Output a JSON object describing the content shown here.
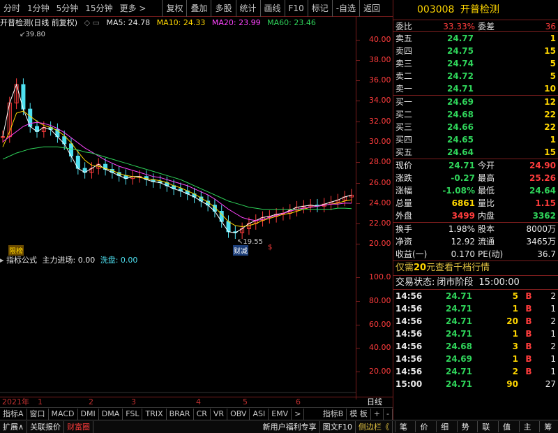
{
  "toolbar": {
    "items": [
      "分时",
      "1分钟",
      "5分钟",
      "15分钟",
      "更多 >",
      "复权",
      "叠加",
      "多股",
      "统计",
      "画线",
      "F10",
      "标记",
      "-自选",
      "返回"
    ]
  },
  "legend": {
    "name": "开普检测(日线 前复权)",
    "ma5": "MA5: 24.78",
    "ma10": "MA10: 24.33",
    "ma20": "MA20: 23.99",
    "ma60": "MA60: 23.46"
  },
  "price_axis": [
    "40.00",
    "38.00",
    "36.00",
    "34.00",
    "32.00",
    "30.00",
    "28.00",
    "26.00",
    "24.00",
    "22.00",
    "20.00"
  ],
  "vol_axis": [
    "100.0",
    "80.00",
    "60.00",
    "40.00",
    "20.00"
  ],
  "annotations": {
    "high": "39.80",
    "low": "19.55",
    "tag1": "限榜",
    "tag2": "财减",
    "tag3": "$"
  },
  "subleg": {
    "name": "指标公式",
    "main_in": "主力进场: 0.00",
    "wash": "洗盘: 0.00"
  },
  "datebar": {
    "year": "2021年",
    "m1": "1",
    "m2": "2",
    "m3": "3",
    "m4": "4",
    "m5": "5",
    "m6": "6",
    "period": "日线"
  },
  "indicators": [
    "指标A",
    "窗口",
    "MACD",
    "DMI",
    "DMA",
    "FSL",
    "TRIX",
    "BRAR",
    "CR",
    "VR",
    "OBV",
    "ASI",
    "EMV",
    ">",
    "指标B",
    "模 板",
    "+",
    "-"
  ],
  "bottombar": {
    "expand": "扩展∧",
    "related": "关联报价",
    "wealth": "财富圈",
    "promo": "新用户福利专享",
    "f10": "图文F10",
    "sidebar": "侧边栏《"
  },
  "panel_tabs": [
    "笔",
    "价",
    "细",
    "势",
    "联",
    "值",
    "主",
    "筹"
  ],
  "stock": {
    "code": "003008",
    "name": "开普检测"
  },
  "weibi": {
    "label": "委比",
    "value": "33.33%",
    "diff_label": "委差",
    "diff": "36"
  },
  "asks": [
    {
      "label": "卖五",
      "price": "24.77",
      "vol": "1"
    },
    {
      "label": "卖四",
      "price": "24.75",
      "vol": "15"
    },
    {
      "label": "卖三",
      "price": "24.74",
      "vol": "5"
    },
    {
      "label": "卖二",
      "price": "24.72",
      "vol": "5"
    },
    {
      "label": "卖一",
      "price": "24.71",
      "vol": "10"
    }
  ],
  "bids": [
    {
      "label": "买一",
      "price": "24.69",
      "vol": "12"
    },
    {
      "label": "买二",
      "price": "24.68",
      "vol": "22"
    },
    {
      "label": "买三",
      "price": "24.66",
      "vol": "22"
    },
    {
      "label": "买四",
      "price": "24.65",
      "vol": "1"
    },
    {
      "label": "买五",
      "price": "24.64",
      "vol": "15"
    }
  ],
  "quote": [
    {
      "l1": "现价",
      "v1": "24.71",
      "c1": "green",
      "l2": "今开",
      "v2": "24.90",
      "c2": "red"
    },
    {
      "l1": "涨跌",
      "v1": "-0.27",
      "c1": "green",
      "l2": "最高",
      "v2": "25.26",
      "c2": "red"
    },
    {
      "l1": "涨幅",
      "v1": "-1.08%",
      "c1": "green",
      "l2": "最低",
      "v2": "24.64",
      "c2": "green"
    },
    {
      "l1": "总量",
      "v1": "6861",
      "c1": "yellow",
      "l2": "量比",
      "v2": "1.15",
      "c2": "red"
    },
    {
      "l1": "外盘",
      "v1": "3499",
      "c1": "red",
      "l2": "内盘",
      "v2": "3362",
      "c2": "green"
    }
  ],
  "fundamentals": [
    {
      "l1": "换手",
      "v1": "1.98%",
      "l2": "股本",
      "v2": "8000万"
    },
    {
      "l1": "净资",
      "v1": "12.92",
      "l2": "流通",
      "v2": "3465万"
    },
    {
      "l1": "收益(一)",
      "v1": "0.170",
      "l2": "PE(动)",
      "v2": "36.7"
    }
  ],
  "promo_line": {
    "pre": "仅需",
    "num": "20",
    "post": "元查看千档行情"
  },
  "trade_status": {
    "label": "交易状态:",
    "value": "闭市阶段",
    "time": "15:00:00"
  },
  "ticks": [
    {
      "t": "14:56",
      "p": "24.71",
      "pc": "green",
      "v": "5",
      "s": "B",
      "n": "2"
    },
    {
      "t": "14:56",
      "p": "24.71",
      "pc": "green",
      "v": "1",
      "s": "B",
      "n": "1"
    },
    {
      "t": "14:56",
      "p": "24.71",
      "pc": "green",
      "v": "20",
      "s": "B",
      "n": "2"
    },
    {
      "t": "14:56",
      "p": "24.71",
      "pc": "green",
      "v": "1",
      "s": "B",
      "n": "1"
    },
    {
      "t": "14:56",
      "p": "24.68",
      "pc": "green",
      "v": "3",
      "s": "B",
      "n": "2"
    },
    {
      "t": "14:56",
      "p": "24.69",
      "pc": "green",
      "v": "1",
      "s": "B",
      "n": "1"
    },
    {
      "t": "14:56",
      "p": "24.71",
      "pc": "green",
      "v": "2",
      "s": "B",
      "n": "1"
    },
    {
      "t": "15:00",
      "p": "24.71",
      "pc": "green",
      "v": "90",
      "s": "",
      "n": "27"
    }
  ],
  "chart_data": [
    {
      "type": "line",
      "title": "开普检测(日线 前复权)",
      "ylim": [
        19,
        41
      ],
      "x": [
        "2021-01-04",
        "2021-01-06",
        "2021-01-08",
        "2021-01-12",
        "2021-01-14",
        "2021-01-18",
        "2021-01-20",
        "2021-01-22",
        "2021-01-26",
        "2021-01-28",
        "2021-02-01",
        "2021-02-03",
        "2021-02-05",
        "2021-02-09",
        "2021-02-19",
        "2021-02-23",
        "2021-02-25",
        "2021-03-01",
        "2021-03-03",
        "2021-03-05",
        "2021-03-09",
        "2021-03-11",
        "2021-03-15",
        "2021-03-17",
        "2021-03-19",
        "2021-03-23",
        "2021-03-25",
        "2021-03-29",
        "2021-03-31",
        "2021-04-02",
        "2021-04-07",
        "2021-04-09",
        "2021-04-13",
        "2021-04-15",
        "2021-04-19",
        "2021-04-21",
        "2021-04-23",
        "2021-04-27",
        "2021-04-29",
        "2021-05-06",
        "2021-05-10",
        "2021-05-12",
        "2021-05-14",
        "2021-05-18",
        "2021-05-20",
        "2021-05-24",
        "2021-05-26",
        "2021-05-28",
        "2021-06-01",
        "2021-06-03",
        "2021-06-07",
        "2021-06-09"
      ],
      "series": [
        {
          "name": "MA5",
          "values": [
            30.5,
            33.8,
            35.6,
            33.2,
            31.5,
            31.0,
            31.4,
            31.2,
            30.5,
            29.8,
            28.6,
            27.4,
            27.0,
            27.4,
            27.8,
            27.3,
            27.0,
            26.7,
            26.4,
            26.6,
            26.6,
            26.3,
            26.1,
            26.0,
            25.7,
            25.4,
            25.2,
            24.9,
            24.6,
            24.2,
            23.8,
            23.2,
            22.2,
            21.2,
            21.1,
            21.5,
            22.0,
            22.3,
            22.6,
            22.7,
            22.9,
            23.0,
            23.3,
            23.6,
            23.7,
            23.8,
            23.7,
            23.9,
            24.1,
            24.3,
            24.6,
            24.78
          ]
        },
        {
          "name": "MA10",
          "values": [
            29.5,
            31.0,
            32.8,
            33.0,
            32.5,
            32.0,
            31.6,
            31.4,
            31.1,
            30.6,
            29.9,
            29.0,
            28.2,
            27.7,
            27.6,
            27.4,
            27.2,
            26.9,
            26.7,
            26.6,
            26.5,
            26.4,
            26.3,
            26.2,
            26.0,
            25.7,
            25.5,
            25.2,
            24.9,
            24.5,
            24.1,
            23.6,
            22.9,
            22.2,
            21.8,
            21.7,
            21.8,
            22.0,
            22.3,
            22.5,
            22.7,
            22.9,
            23.0,
            23.2,
            23.4,
            23.6,
            23.7,
            23.8,
            23.9,
            24.0,
            24.2,
            24.33
          ]
        },
        {
          "name": "MA20",
          "values": [
            30.0,
            30.5,
            31.0,
            31.5,
            31.8,
            31.9,
            31.8,
            31.6,
            31.3,
            30.9,
            30.4,
            29.9,
            29.4,
            29.0,
            28.6,
            28.2,
            27.9,
            27.6,
            27.4,
            27.2,
            27.0,
            26.8,
            26.6,
            26.5,
            26.3,
            26.1,
            25.9,
            25.7,
            25.4,
            25.1,
            24.8,
            24.4,
            23.9,
            23.4,
            23.0,
            22.6,
            22.4,
            22.3,
            22.4,
            22.6,
            22.8,
            23.0,
            23.2,
            23.4,
            23.5,
            23.6,
            23.7,
            23.8,
            23.9,
            23.9,
            24.0,
            23.99
          ]
        },
        {
          "name": "MA60",
          "values": [
            28.3,
            28.6,
            28.9,
            29.1,
            29.3,
            29.4,
            29.5,
            29.5,
            29.5,
            29.4,
            29.3,
            29.2,
            29.0,
            28.9,
            28.7,
            28.5,
            28.3,
            28.1,
            27.9,
            27.7,
            27.5,
            27.3,
            27.1,
            26.9,
            26.7,
            26.5,
            26.3,
            26.0,
            25.7,
            25.4,
            25.1,
            24.8,
            24.5,
            24.2,
            24.0,
            23.8,
            23.6,
            23.5,
            23.4,
            23.4,
            23.4,
            23.4,
            23.4,
            23.4,
            23.4,
            23.4,
            23.4,
            23.4,
            23.4,
            23.5,
            23.5,
            23.46
          ]
        }
      ]
    },
    {
      "type": "bar",
      "title": "指标公式",
      "ylim": [
        0,
        110
      ],
      "series": [
        {
          "name": "主力进场",
          "values": [
            0,
            0,
            0,
            0,
            0,
            0,
            0,
            0,
            0,
            0,
            0,
            0,
            0,
            0,
            0,
            0,
            0,
            0,
            0,
            0,
            0,
            0,
            0,
            0,
            0,
            0,
            0,
            0,
            0,
            0,
            0,
            0,
            0,
            0,
            0,
            0,
            0,
            0,
            0,
            0,
            0,
            0,
            0,
            0,
            0,
            0,
            0,
            0,
            0,
            0,
            0,
            0.0
          ]
        },
        {
          "name": "洗盘",
          "values": [
            0,
            0,
            0,
            0,
            0,
            0,
            0,
            0,
            0,
            0,
            0,
            0,
            0,
            0,
            0,
            0,
            0,
            0,
            0,
            0,
            0,
            0,
            0,
            0,
            0,
            0,
            0,
            0,
            0,
            0,
            0,
            0,
            0,
            0,
            0,
            0,
            0,
            0,
            0,
            0,
            0,
            0,
            0,
            0,
            0,
            0,
            0,
            0,
            0,
            0,
            0,
            0.0
          ]
        }
      ]
    }
  ]
}
